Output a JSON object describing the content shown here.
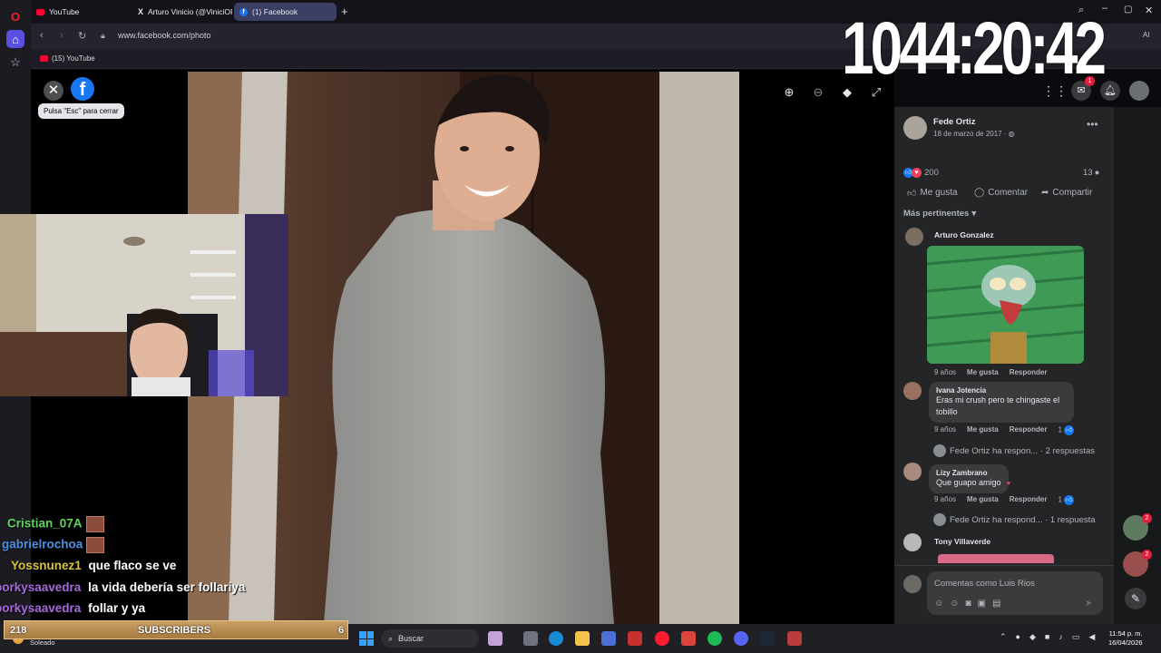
{
  "browser": {
    "tabs": [
      {
        "label": "YouTube",
        "icon": "youtube-icon"
      },
      {
        "label": "Arturo Vinicio (@ViniciOP...",
        "icon": "x-icon"
      },
      {
        "label": "(1) Facebook",
        "icon": "facebook-icon"
      }
    ],
    "url": "www.facebook.com/photo",
    "bookmark": "(15) YouTube",
    "toolbar_right": "AI"
  },
  "clock_overlay": "1044:20:42",
  "viewer": {
    "close_tooltip": "Pulsa \"Esc\" para cerrar",
    "fb_letter": "f"
  },
  "post": {
    "author": "Fede Ortiz",
    "date": "18 de marzo de 2017 · ",
    "reactions_count": "200",
    "comments_count": "13",
    "actions": {
      "like": "Me gusta",
      "comment": "Comentar",
      "share": "Compartir"
    },
    "sort_label": "Más pertinentes"
  },
  "comments": [
    {
      "name": "Arturo Gonzalez",
      "age": "9 años",
      "like": "Me gusta",
      "reply": "Responder"
    },
    {
      "name": "Ivana Jotencia",
      "text": "Eras mi crush pero te chingaste el tobillo",
      "age": "9 años",
      "like": "Me gusta",
      "reply": "Responder",
      "likes": "1"
    },
    {
      "reply_summary": "Fede Ortiz ha respon... · 2 respuestas"
    },
    {
      "name": "Lizy Zambrano",
      "text": "Que guapo amigo",
      "age": "9 años",
      "like": "Me gusta",
      "reply": "Responder",
      "likes": "1"
    },
    {
      "reply_summary": "Fede Ortiz ha respond... · 1 respuesta"
    },
    {
      "name": "Tony Villaverde"
    }
  ],
  "composer_placeholder": "Comentas como Luis Rios",
  "badges": {
    "messenger": "1",
    "side_chat_1": "2",
    "side_chat_2": "2"
  },
  "stream_chat": [
    {
      "user": "Cristian_07A",
      "message": "",
      "color": "#5fd35f"
    },
    {
      "user": "gabrielrochoa",
      "message": "",
      "color": "#4a90e2"
    },
    {
      "user": "Yossnunez1",
      "message": "que flaco se ve",
      "color": "#d9c23a"
    },
    {
      "user": "porkysaavedra",
      "message": "la vida debería ser follariya",
      "color": "#a46bd9"
    },
    {
      "user": "porkysaavedra",
      "message": "follar y ya",
      "color": "#a46bd9"
    }
  ],
  "sub_bar": {
    "count_left": "218",
    "label": "SUBSCRIBERS",
    "count_right": "6"
  },
  "taskbar": {
    "search": "Buscar",
    "weather": "Soleado",
    "time": "11:54 p. m.",
    "date": "16/04/2026"
  }
}
